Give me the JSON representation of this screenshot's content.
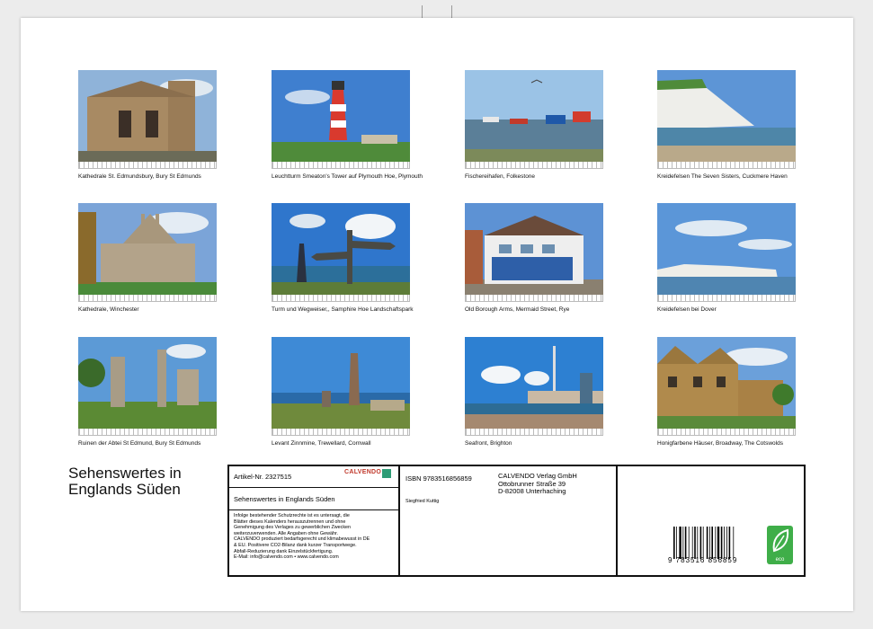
{
  "calendar": {
    "title_lines": [
      "Sehenswertes in",
      "Englands Süden"
    ],
    "photos": [
      {
        "caption": "Kathedrale St. Edmundsbury, Bury St Edmunds",
        "scene": "cathedral"
      },
      {
        "caption": "Leuchtturm Smeaton's Tower auf Plymouth Hoe, Plymouth",
        "scene": "lighthouse"
      },
      {
        "caption": "Fischereihafen, Folkestone",
        "scene": "harbour"
      },
      {
        "caption": "Kreidefelsen The Seven Sisters, Cuckmere Haven",
        "scene": "cliffs"
      },
      {
        "caption": "Kathedrale, Winchester",
        "scene": "cathedral2"
      },
      {
        "caption": "Turm und Wegweiser,, Samphire Hoe Landschaftspark",
        "scene": "signpost"
      },
      {
        "caption": "Old Borough Arms, Mermaid Street, Rye",
        "scene": "pub"
      },
      {
        "caption": "Kreidefelsen bei Dover",
        "scene": "dover"
      },
      {
        "caption": "Ruinen der Abtei St Edmund, Bury St Edmunds",
        "scene": "ruins"
      },
      {
        "caption": "Levant Zinnmine, Trewellard, Cornwall",
        "scene": "mine"
      },
      {
        "caption": "Seafront, Brighton",
        "scene": "brighton"
      },
      {
        "caption": "Honigfarbene Häuser, Broadway, The Cotswolds",
        "scene": "cotswolds"
      }
    ]
  },
  "info": {
    "article_no": "Artikel-Nr. 2327515",
    "brand": "CALVENDO",
    "subtitle": "Sehenswertes in Englands Süden",
    "legal_lines": [
      "Infolge bestehender Schutzrechte ist es untersagt, die",
      "Blätter dieses Kalenders herauszutrennen und ohne",
      "Genehmigung des Verlages zu gewerblichen Zwecken",
      "weiterzuverwenden. Alle Angaben ohne Gewähr.",
      "CALVENDO produziert bedarfsgerecht und klimabewusst in DE",
      "& EU. Positivere CO2-Bilanz dank kurzer Transportwege.",
      "Abfall-Reduzierung dank Einzelstückfertigung.",
      "E-Mail: info@calvendo.com • www.calvendo.com"
    ],
    "isbn": "ISBN 9783516856859",
    "author": "Siegfried Kuttig",
    "publisher_lines": [
      "CALVENDO Verlag GmbH",
      "Ottobrunner Straße 39",
      "D-82008 Unterhaching"
    ],
    "barcode_digits": "9 783516 856859",
    "eco_label": "eco"
  },
  "colors": {
    "frame": "#111111",
    "eco_green": "#3fae49",
    "brand_red": "#c0392b"
  }
}
